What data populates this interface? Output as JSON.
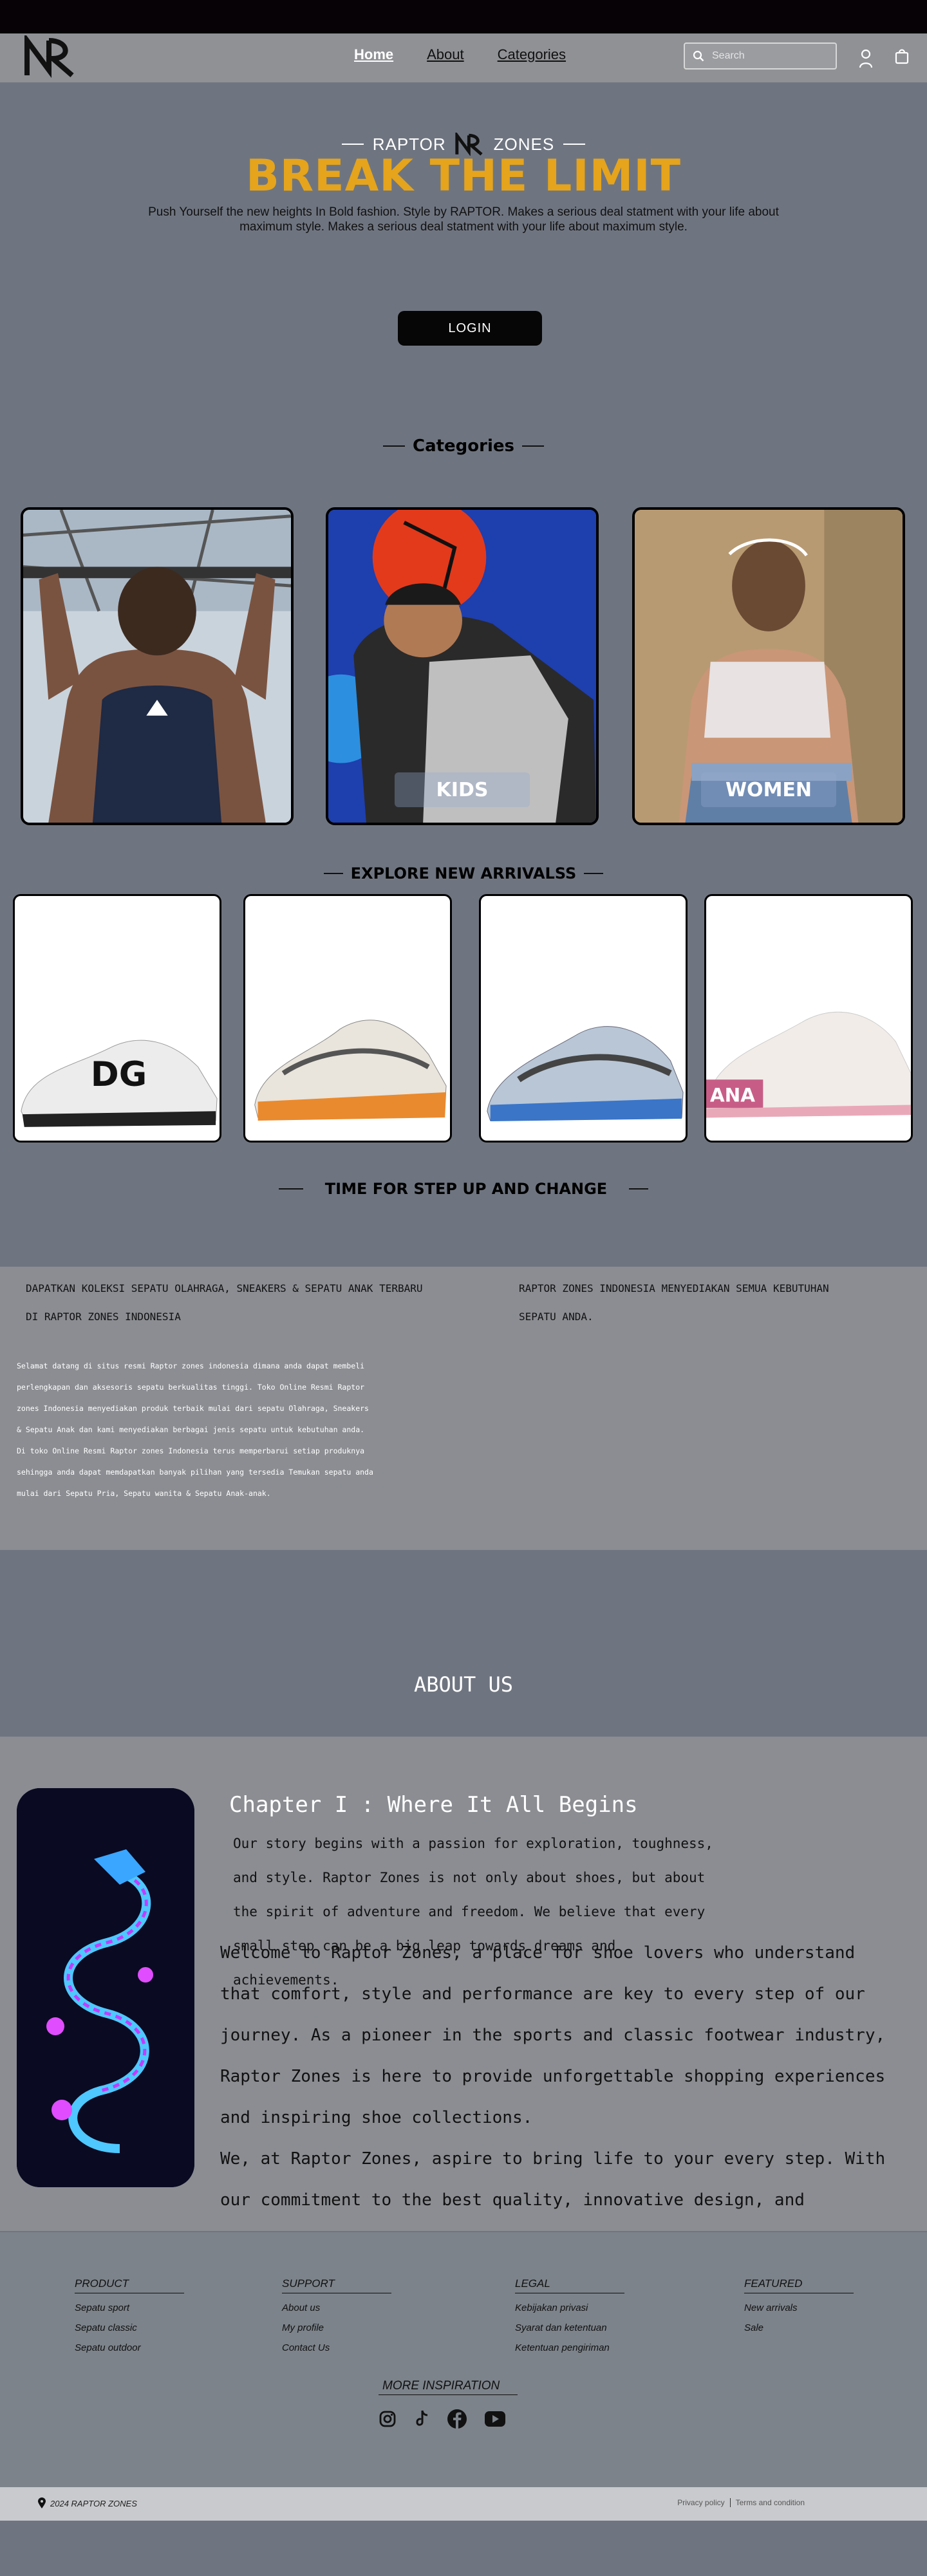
{
  "nav": {
    "links": [
      "Home",
      "About",
      "Categories"
    ],
    "search_placeholder": "Search"
  },
  "hero": {
    "brand_left": "RAPTOR",
    "brand_right": "ZONES",
    "title": "BREAK THE LIMIT",
    "description": "Push Yourself the new heights In Bold fashion. Style by RAPTOR. Makes a serious deal statment with your life about maximum style. Makes a serious deal statment with your life about maximum style.",
    "login_label": "LOGIN"
  },
  "categories": {
    "heading": "Categories",
    "cards": [
      {
        "label": ""
      },
      {
        "label": "KIDS"
      },
      {
        "label": "WOMEN"
      }
    ]
  },
  "arrivals": {
    "heading": "EXPLORE NEW ARRIVALSS"
  },
  "info": {
    "heading": "TIME FOR STEP UP AND CHANGE",
    "left_heading": "DAPATKAN KOLEKSI SEPATU OLAHRAGA, SNEAKERS & SEPATU ANAK TERBARU DI RAPTOR ZONES INDONESIA",
    "right_heading": "RAPTOR ZONES INDONESIA MENYEDIAKAN SEMUA KEBUTUHAN SEPATU ANDA.",
    "body": "Selamat datang di situs resmi Raptor zones indonesia dimana anda dapat membeli perlengkapan dan aksesoris sepatu berkualitas tinggi. Toko Online Resmi Raptor zones Indonesia menyediakan  produk terbaik mulai dari sepatu Olahraga, Sneakers & Sepatu Anak dan kami menyediakan  berbagai jenis sepatu untuk kebutuhan anda. Di toko Online Resmi Raptor zones Indonesia terus  memperbarui setiap produknya sehingga anda dapat memdapatkan banyak pilihan yang tersedia Temukan sepatu anda mulai dari Sepatu Pria, Sepatu wanita & Sepatu Anak-anak."
  },
  "about": {
    "title": "ABOUT US",
    "chapter": "Chapter I : Where It All Begins",
    "chapter_text": "Our story begins with a passion for exploration, toughness, and style. Raptor Zones is not only about shoes, but about the spirit of adventure and freedom. We believe that every small step can be a big leap towards dreams and achievements.",
    "welcome": "Welcome to Raptor Zones, a place for shoe lovers who understand that comfort, style and performance are key to every step of our journey. As a pioneer in the sports and classic footwear industry, Raptor Zones is here to provide unforgettable shopping experiences and inspiring shoe collections.",
    "welcome_2": "We, at Raptor Zones, aspire to bring life to your every step. With our commitment to the best quality, innovative design, and"
  },
  "footer": {
    "columns": [
      {
        "heading": "PRODUCT",
        "items": [
          "Sepatu sport",
          "Sepatu classic",
          "Sepatu outdoor"
        ]
      },
      {
        "heading": "SUPPORT",
        "items": [
          "About us",
          "My profile",
          "Contact Us"
        ]
      },
      {
        "heading": "LEGAL",
        "items": [
          "Kebijakan privasi",
          "Syarat dan ketentuan",
          "Ketentuan pengiriman"
        ]
      },
      {
        "heading": "FEATURED",
        "items": [
          "New arrivals",
          "Sale"
        ]
      }
    ],
    "more_inspiration": "MORE INSPIRATION",
    "copyright": "2024 RAPTOR ZONES",
    "privacy": "Privacy policy",
    "terms": "Terms and condition"
  },
  "icons": [
    "search-icon",
    "user-icon",
    "bag-icon",
    "instagram-icon",
    "tiktok-icon",
    "facebook-icon",
    "youtube-icon",
    "location-pin-icon"
  ]
}
